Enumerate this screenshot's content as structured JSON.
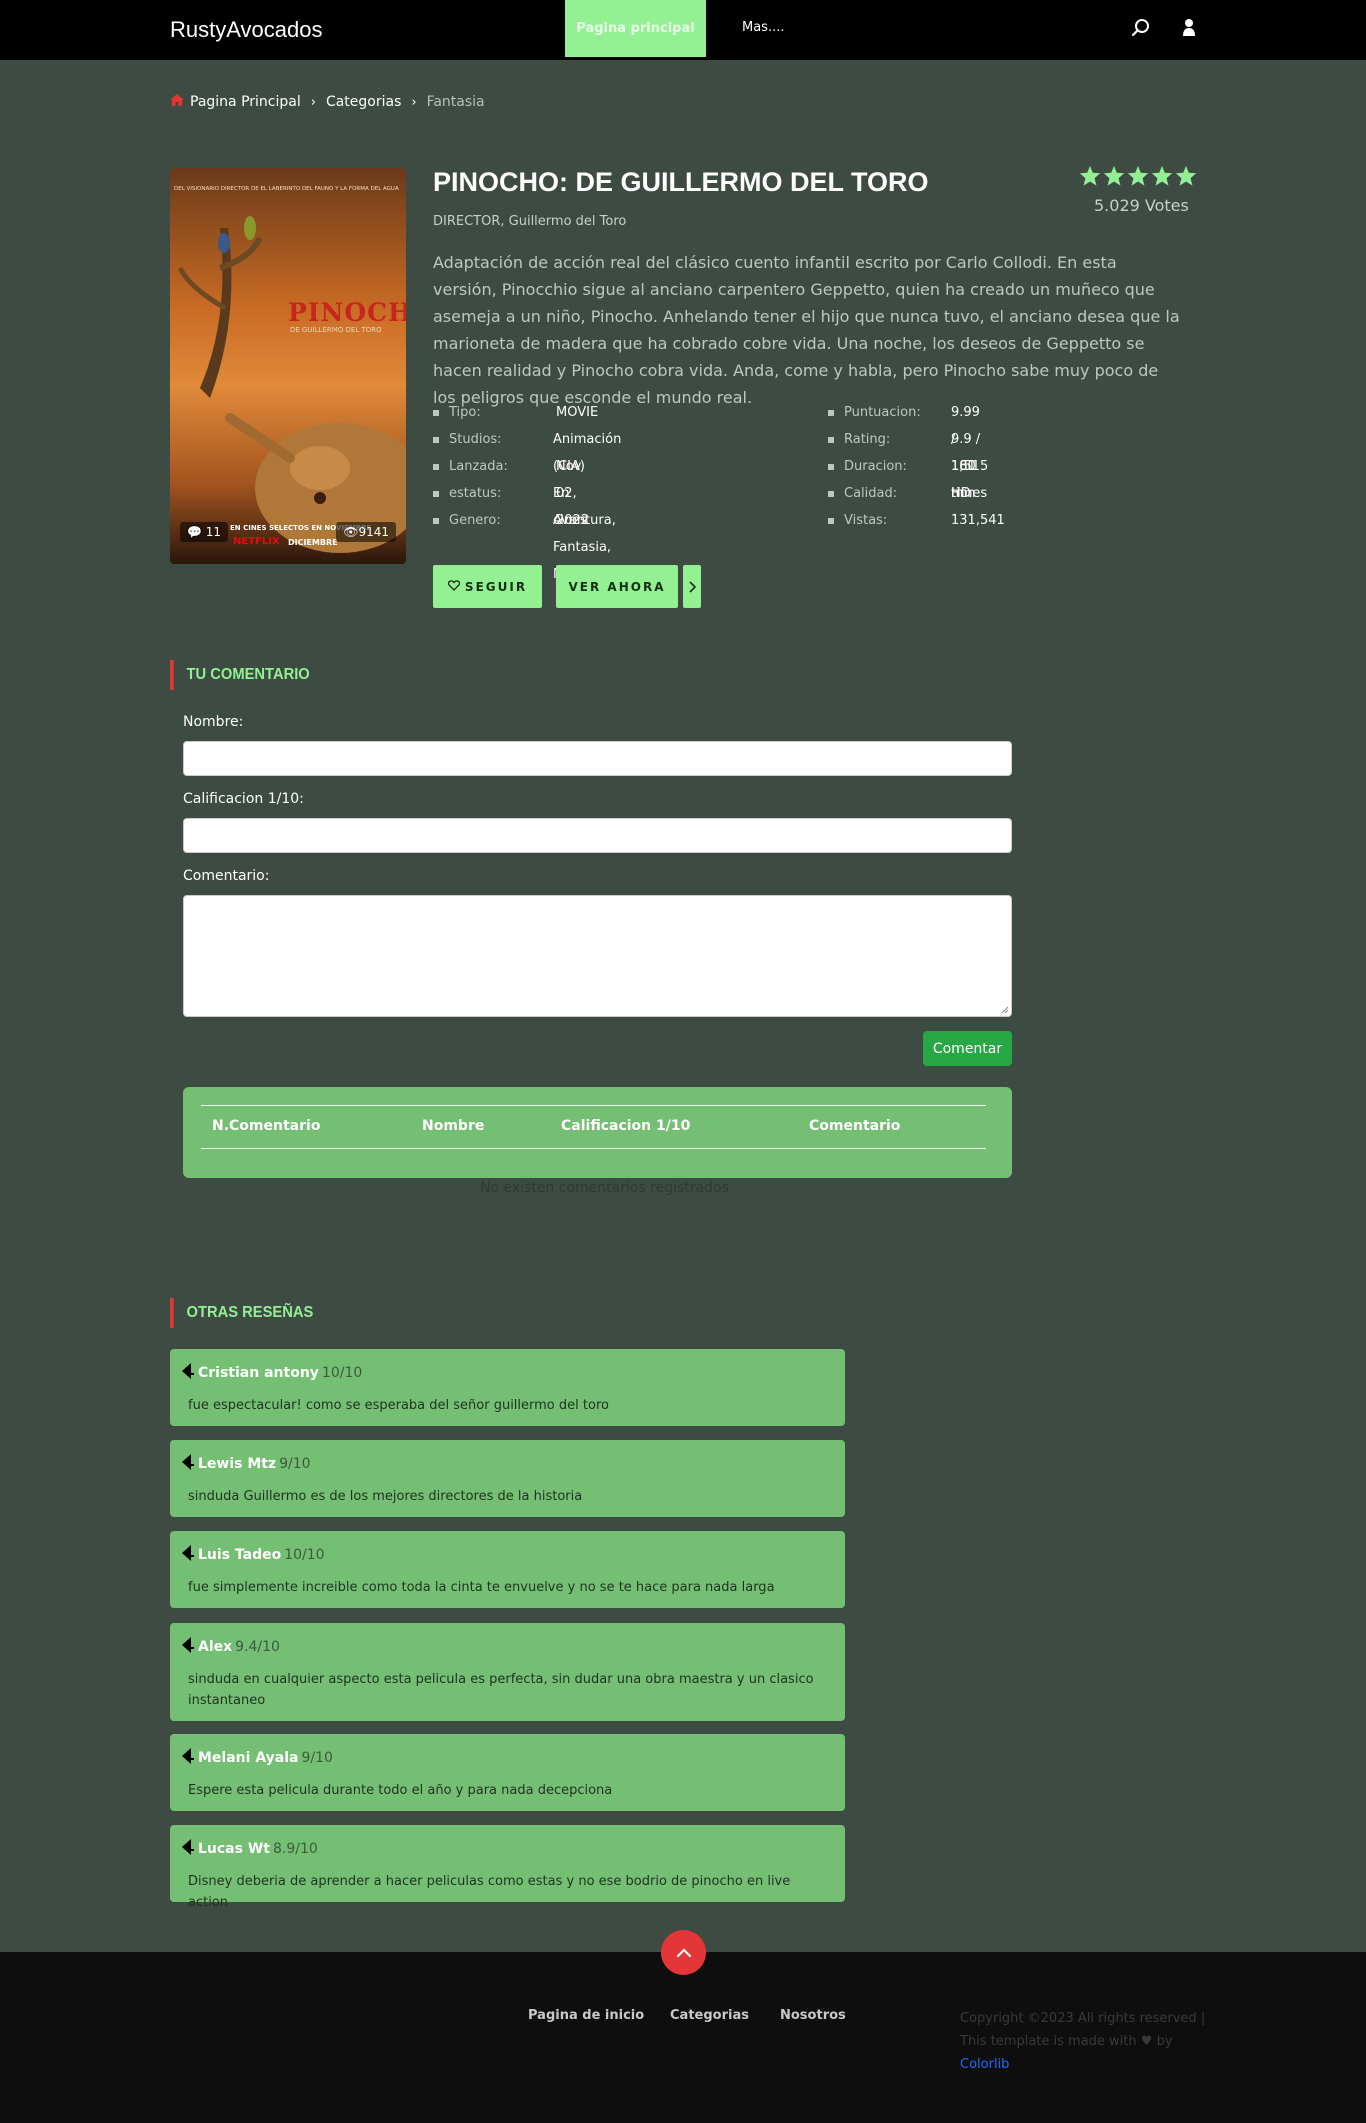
{
  "header": {
    "logo": "RustyAvocados",
    "nav_home": "Pagina principal",
    "nav_more": "Mas....",
    "icons": [
      "search-icon",
      "user-icon"
    ]
  },
  "breadcrumb": {
    "home": "Pagina Principal",
    "categories": "Categorias",
    "current": "Fantasia"
  },
  "poster": {
    "top_text": "DEL VISIONARIO DIRECTOR DE EL LABERINTO DEL FAUNO Y LA FORMA DEL AGUA",
    "title": "PINOCHO",
    "subtitle": "DE GUILLERMO DEL TORO",
    "bottom_text": "EN CINES SELECTOS EN NOVIEMBRE",
    "network": "NETFLIX",
    "release_month": "DICIEMBRE",
    "comments": "11",
    "views": "9141"
  },
  "movie": {
    "title": "PINOCHO: DE GUILLERMO DEL TORO",
    "director": "DIRECTOR, Guillermo del Toro",
    "rating_stars": 5,
    "votes": "5.029 Votes",
    "description": "Adaptación de acción real del clásico cuento infantil escrito por Carlo Collodi. En esta versión, Pinocchio sigue al anciano carpentero Geppetto, quien ha creado un muñeco que asemeja a un niño, Pinocho. Anhelando tener el hijo que nunca tuvo, el anciano desea que la marioneta de madera que ha cobrado cobre vida. Una noche, los deseos de Geppetto se hacen realidad y Pinocho cobra vida. Anda, come y habla, pero Pinocho sabe muy poco de los peligros que esconde el mundo real.",
    "info_left": [
      {
        "key": "Tipo:",
        "value": "MOVIE"
      },
      {
        "key": "Studios:",
        "value": "Animación (CIA)"
      },
      {
        "key": "Lanzada:",
        "value": "Nov 02, 2022"
      },
      {
        "key": "estatus:",
        "value": "En cines"
      },
      {
        "key": "Genero:",
        "value": "Aventura, Fantasia, Magico"
      }
    ],
    "info_right": [
      {
        "key": "Puntuacion:",
        "value": "9.99 / 1,515"
      },
      {
        "key": "Rating:",
        "value": "9.9 / 161 times"
      },
      {
        "key": "Duracion:",
        "value": "180 min"
      },
      {
        "key": "Calidad:",
        "value": "HD"
      },
      {
        "key": "Vistas:",
        "value": "131,541"
      }
    ],
    "follow_button": "SEGUIR",
    "watch_button": "VER AHORA"
  },
  "comment_form": {
    "section_title": "TU COMENTARIO",
    "name_label": "Nombre:",
    "rating_label": "Calificacion 1/10:",
    "comment_label": "Comentario:",
    "submit": "Comentar",
    "table_headers": [
      "N.Comentario",
      "Nombre",
      "Calificacion 1/10",
      "Comentario"
    ],
    "empty_message": "No existen comentarios registrados"
  },
  "reviews": {
    "section_title": "OTRAS RESEÑAS",
    "items": [
      {
        "name": "Cristian antony",
        "score": "10/10",
        "text": "fue espectacular! como se esperaba del señor guillermo del toro"
      },
      {
        "name": "Lewis Mtz",
        "score": "9/10",
        "text": "sinduda Guillermo es de los mejores directores de la historia"
      },
      {
        "name": "Luis Tadeo",
        "score": "10/10",
        "text": "fue simplemente increible como toda la cinta te envuelve y no se te hace para nada larga"
      },
      {
        "name": "Alex",
        "score": "9.4/10",
        "text": "sinduda en cualquier aspecto esta pelicula es perfecta, sin dudar una obra maestra y un clasico instantaneo"
      },
      {
        "name": "Melani Ayala",
        "score": "9/10",
        "text": "Espere esta pelicula durante todo el año y para nada decepciona"
      },
      {
        "name": "Lucas Wt",
        "score": "8.9/10",
        "text": "Disney deberia de aprender a hacer peliculas como estas y no ese bodrio de pinocho en live action"
      }
    ]
  },
  "footer": {
    "links": [
      "Pagina de inicio",
      "Categorias",
      "Nosotros"
    ],
    "copyright": "Copyright ©2023 All rights reserved | This template is made with",
    "by": "by",
    "credit": "Colorlib"
  },
  "colors": {
    "accent_green": "#93f093",
    "card_green": "#75bf75",
    "accent_red": "#e53637",
    "background": "#3d4b42"
  }
}
